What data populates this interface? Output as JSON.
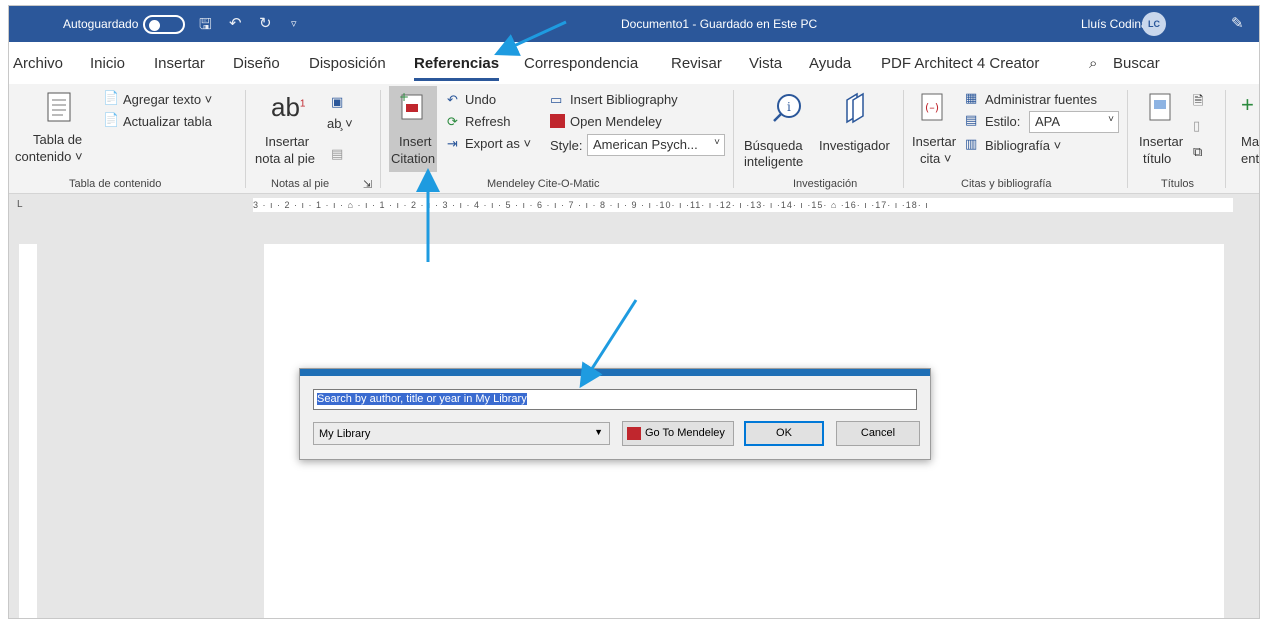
{
  "titlebar": {
    "autosave_label": "Autoguardado",
    "document_title": "Documento1 - Guardado en Este PC",
    "user_name": "Lluís Codina",
    "user_initials": "LC"
  },
  "tabs": [
    "Archivo",
    "Inicio",
    "Insertar",
    "Diseño",
    "Disposición",
    "Referencias",
    "Correspondencia",
    "Revisar",
    "Vista",
    "Ayuda",
    "PDF Architect 4 Creator",
    "Buscar"
  ],
  "active_tab": "Referencias",
  "ribbon": {
    "tabla": {
      "tabla_line1": "Tabla de",
      "tabla_line2": "contenido ˅",
      "agregar": "Agregar texto ˅",
      "actualizar": "Actualizar tabla",
      "group": "Tabla de contenido"
    },
    "notas": {
      "ab": "ab",
      "sup": "1",
      "insertar_line1": "Insertar",
      "insertar_line2": "nota al pie",
      "group": "Notas al pie"
    },
    "mendeley": {
      "insert_line1": "Insert",
      "insert_line2": "Citation",
      "undo": "Undo",
      "refresh": "Refresh",
      "export": "Export as ˅",
      "insert_bib": "Insert Bibliography",
      "open": "Open Mendeley",
      "style_label": "Style:",
      "style_value": "American Psych...",
      "group": "Mendeley Cite-O-Matic"
    },
    "investigacion": {
      "busqueda_line1": "Búsqueda",
      "busqueda_line2": "inteligente",
      "investigador": "Investigador",
      "group": "Investigación"
    },
    "citas": {
      "insertar_line1": "Insertar",
      "insertar_line2": "cita ˅",
      "administrar": "Administrar fuentes",
      "estilo_label": "Estilo:",
      "estilo_value": "APA",
      "bibliografia": "Bibliografía ˅",
      "group": "Citas y bibliografía"
    },
    "titulos": {
      "insertar_line1": "Insertar",
      "insertar_line2": "título",
      "group": "Títulos"
    },
    "marcar": {
      "line1": "Mar",
      "line2": "entr"
    }
  },
  "ruler_text": "3 · ı · 2 · ı · 1 · ı · ⌂ · ı · 1 · ı · 2 · ı · 3 · ı · 4 · ı · 5 · ı · 6 · ı · 7 · ı · 8 · ı · 9 · ı ·10· ı ·11· ı ·12· ı ·13· ı ·14· ı ·15· ⌂ ·16· ı ·17· ı ·18· ı",
  "dialog": {
    "search_placeholder": "Search by author, title or year in My Library",
    "library": "My Library",
    "goto": "Go To Mendeley",
    "ok": "OK",
    "cancel": "Cancel"
  },
  "colors": {
    "titlebar": "#2b579a",
    "arrow": "#1e9be0",
    "dialog_accent": "#1f6fb6",
    "mendeley_red": "#c0262d"
  }
}
